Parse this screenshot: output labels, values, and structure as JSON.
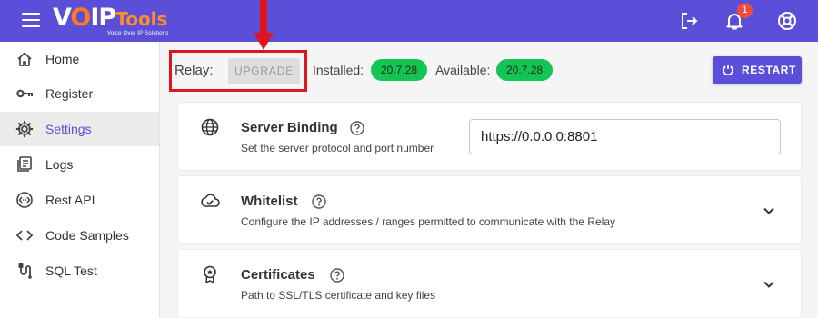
{
  "header": {
    "logo": {
      "v": "V",
      "o": "O",
      "ip": "IP",
      "tools": "Tools",
      "tagline": "Voice Over IP Solutions"
    },
    "notification_count": "1",
    "icons": [
      "menu-icon",
      "logout-icon",
      "bell-icon",
      "support-icon"
    ],
    "accent": "#5b4fd9"
  },
  "sidebar": {
    "items": [
      {
        "label": "Home",
        "icon": "home-icon"
      },
      {
        "label": "Register",
        "icon": "key-icon"
      },
      {
        "label": "Settings",
        "icon": "gear-icon",
        "active": true
      },
      {
        "label": "Logs",
        "icon": "logs-icon"
      },
      {
        "label": "Rest API",
        "icon": "api-icon"
      },
      {
        "label": "Code Samples",
        "icon": "code-icon"
      },
      {
        "label": "SQL Test",
        "icon": "sql-icon"
      }
    ]
  },
  "status": {
    "relay_label": "Relay:",
    "upgrade_label": "UPGRADE",
    "installed_label": "Installed:",
    "installed_version": "20.7.28",
    "available_label": "Available:",
    "available_version": "20.7.28",
    "restart_label": "RESTART",
    "version_color": "#16c456",
    "highlight_color": "#e0141a"
  },
  "cards": [
    {
      "title": "Server Binding",
      "description": "Set the server protocol and port number",
      "icon": "globe-icon",
      "input_value": "https://0.0.0.0:8801"
    },
    {
      "title": "Whitelist",
      "description": "Configure the IP addresses / ranges permitted to communicate with the Relay",
      "icon": "cloud-check-icon"
    },
    {
      "title": "Certificates",
      "description": "Path to SSL/TLS certificate and key files",
      "icon": "certificate-icon"
    }
  ]
}
